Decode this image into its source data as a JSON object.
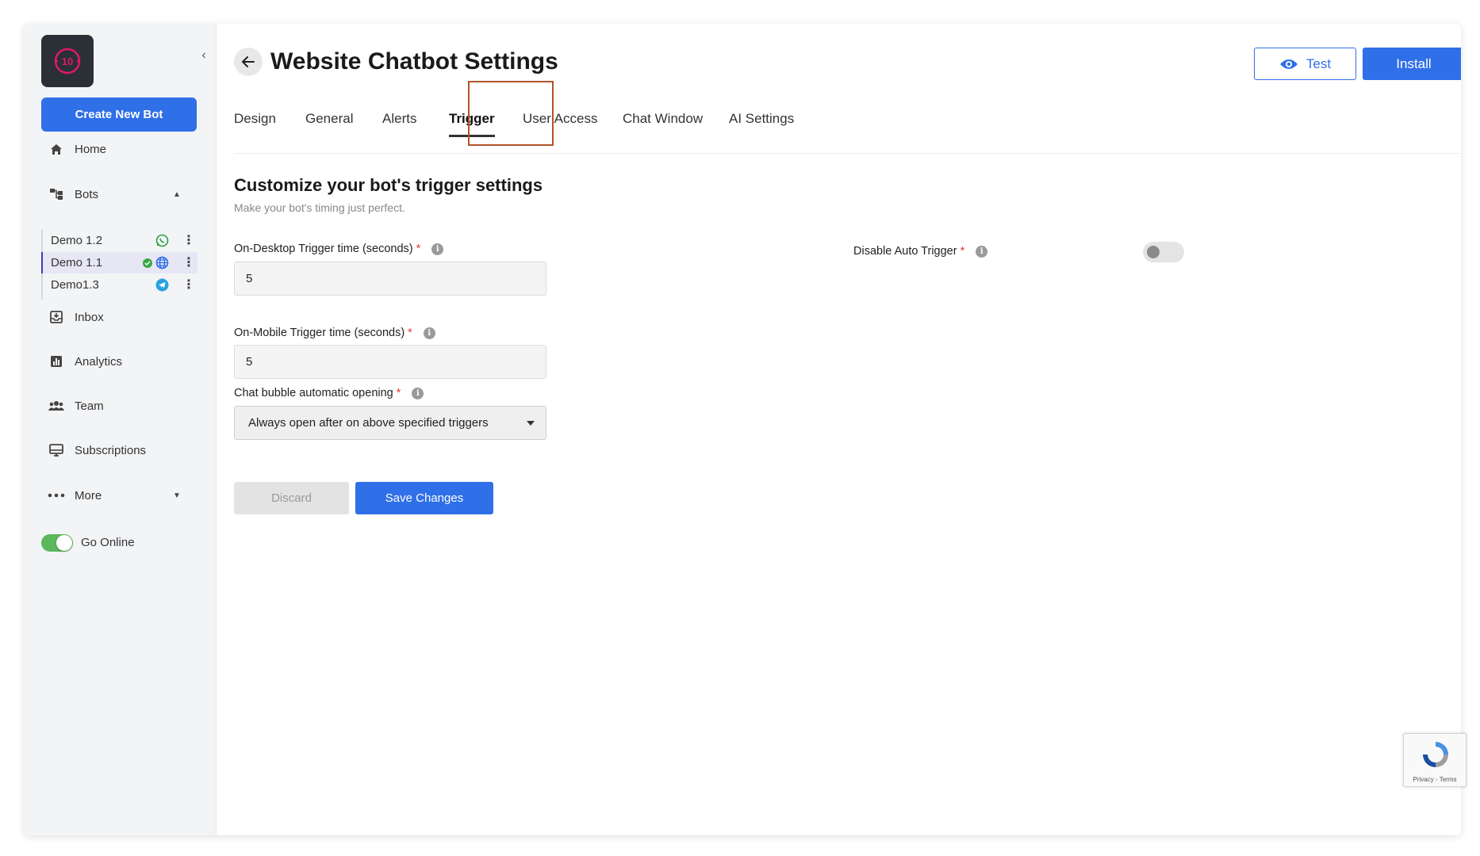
{
  "sidebar": {
    "create_label": "Create New Bot",
    "collapse_icon": "chevron-left-icon",
    "items": [
      {
        "label": "Home",
        "icon": "home-icon"
      },
      {
        "label": "Bots",
        "icon": "bots-icon"
      },
      {
        "label": "Inbox",
        "icon": "inbox-icon"
      },
      {
        "label": "Analytics",
        "icon": "analytics-icon"
      },
      {
        "label": "Team",
        "icon": "team-icon"
      },
      {
        "label": "Subscriptions",
        "icon": "subscriptions-icon"
      },
      {
        "label": "More",
        "icon": "more-icon"
      }
    ],
    "bots": [
      {
        "name": "Demo 1.2",
        "channel": "whatsapp-icon"
      },
      {
        "name": "Demo 1.1",
        "channel": "globe-icon",
        "active": true
      },
      {
        "name": "Demo1.3",
        "channel": "telegram-icon"
      }
    ],
    "go_online_label": "Go Online",
    "go_online": true
  },
  "header": {
    "title": "Website Chatbot Settings",
    "test_label": "Test",
    "install_label": "Install"
  },
  "tabs": [
    {
      "label": "Design"
    },
    {
      "label": "General"
    },
    {
      "label": "Alerts"
    },
    {
      "label": "Trigger",
      "active": true
    },
    {
      "label": "User Access"
    },
    {
      "label": "Chat Window"
    },
    {
      "label": "AI Settings"
    }
  ],
  "section": {
    "title": "Customize your bot's trigger settings",
    "subtitle": "Make your bot's timing just perfect."
  },
  "form": {
    "desktop_label": "On-Desktop Trigger time (seconds)",
    "desktop_value": "5",
    "mobile_label": "On-Mobile Trigger time (seconds)",
    "mobile_value": "5",
    "bubble_label": "Chat bubble automatic opening",
    "bubble_value": "Always open after on above specified triggers",
    "required_mark": "*",
    "info_mark": "i",
    "auto_trigger_label": "Disable Auto Trigger",
    "auto_trigger_enabled": false
  },
  "actions": {
    "discard_label": "Discard",
    "save_label": "Save Changes"
  },
  "recaptcha": {
    "text": "Privacy - Terms"
  },
  "colors": {
    "primary": "#2f6fe8",
    "online": "#5cb85c",
    "required": "#e53935",
    "highlight": "#b0542a"
  }
}
